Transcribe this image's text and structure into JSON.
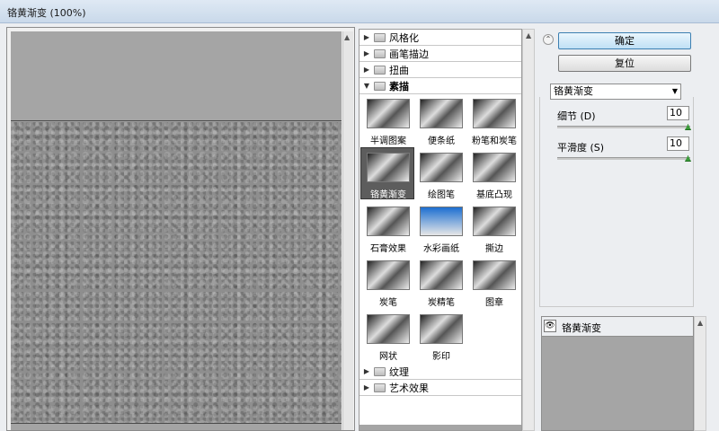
{
  "window": {
    "title": "铬黄渐变 (100%)"
  },
  "gallery": {
    "folders_top": [
      {
        "label": "风格化",
        "expanded": false
      },
      {
        "label": "画笔描边",
        "expanded": false
      },
      {
        "label": "扭曲",
        "expanded": false
      },
      {
        "label": "素描",
        "expanded": true
      }
    ],
    "thumbs": [
      {
        "label": "半调图案"
      },
      {
        "label": "便条纸"
      },
      {
        "label": "粉笔和炭笔"
      },
      {
        "label": "铬黄渐变",
        "selected": true
      },
      {
        "label": "绘图笔"
      },
      {
        "label": "基底凸现"
      },
      {
        "label": "石膏效果"
      },
      {
        "label": "水彩画纸"
      },
      {
        "label": "撕边"
      },
      {
        "label": "炭笔"
      },
      {
        "label": "炭精笔"
      },
      {
        "label": "图章"
      },
      {
        "label": "网状"
      },
      {
        "label": "影印"
      }
    ],
    "folders_bottom": [
      {
        "label": "纹理",
        "expanded": false
      },
      {
        "label": "艺术效果",
        "expanded": false
      }
    ]
  },
  "controls": {
    "ok_label": "确定",
    "reset_label": "复位",
    "filter_selected": "铬黄渐变",
    "params": [
      {
        "label": "细节 (D)",
        "value": "10"
      },
      {
        "label": "平滑度 (S)",
        "value": "10"
      }
    ]
  },
  "layers": {
    "name": "铬黄渐变"
  },
  "icons": {
    "collapse": "double-chevron-up-icon",
    "folder": "folder-icon",
    "eye": "eye-icon"
  }
}
